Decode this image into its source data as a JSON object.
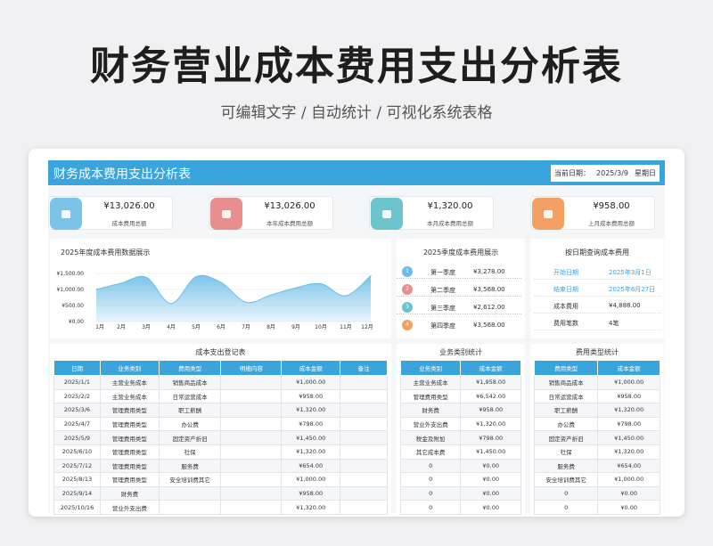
{
  "hero": {
    "title": "财务营业成本费用支出分析表",
    "subtitle": "可编辑文字 / 自动统计 / 可视化系统表格"
  },
  "header": {
    "title": "财务成本费用支出分析表",
    "date_label": "当前日期：",
    "date_value": "2025/3/9",
    "weekday": "星期日"
  },
  "kpis": [
    {
      "value": "¥13,026.00",
      "label": "成本费用总额",
      "color": "#7cc3e8"
    },
    {
      "value": "¥13,026.00",
      "label": "本年成本费用总额",
      "color": "#e88e8e"
    },
    {
      "value": "¥1,320.00",
      "label": "本月成本费用总额",
      "color": "#6ec4cc"
    },
    {
      "value": "¥958.00",
      "label": "上月成本费用总额",
      "color": "#f4a062"
    }
  ],
  "yearly_chart_title": "2025年度成本费用数据展示",
  "chart_data": {
    "type": "area",
    "title": "2025年度成本费用数据展示",
    "categories": [
      "1月",
      "2月",
      "3月",
      "4月",
      "5月",
      "6月",
      "7月",
      "8月",
      "9月",
      "10月",
      "11月",
      "12月"
    ],
    "values": [
      1000,
      1200,
      1380,
      560,
      1400,
      1220,
      600,
      830,
      1050,
      1180,
      800,
      1430
    ],
    "yticks": [
      "¥1,500.00",
      "¥1,000.00",
      "¥500.00",
      "¥0.00"
    ],
    "ylim": [
      0,
      1500
    ],
    "color": "#6cbce8"
  },
  "quarter": {
    "title": "2025季度成本费用展示",
    "rows": [
      {
        "n": "1",
        "name": "第一季度",
        "value": "¥3,278.00",
        "color": "#6cbce8"
      },
      {
        "n": "2",
        "name": "第二季度",
        "value": "¥3,568.00",
        "color": "#e88e8e"
      },
      {
        "n": "3",
        "name": "第三季度",
        "value": "¥2,612.00",
        "color": "#6ec4cc"
      },
      {
        "n": "4",
        "name": "第四季度",
        "value": "¥3,568.00",
        "color": "#f4a062"
      }
    ]
  },
  "query": {
    "title": "按日期查询成本费用",
    "rows": [
      {
        "k": "开始日期",
        "v": "2025年3月1日",
        "hl": true
      },
      {
        "k": "结束日期",
        "v": "2025年6月27日",
        "hl": true
      },
      {
        "k": "成本费用",
        "v": "¥4,888.00",
        "hl": false
      },
      {
        "k": "费用笔数",
        "v": "4笔",
        "hl": false
      }
    ]
  },
  "ledger": {
    "title": "成本支出登记表",
    "headers": [
      "日期",
      "业务类别",
      "费用类型",
      "明细内容",
      "成本金额",
      "备注"
    ],
    "rows": [
      [
        "2025/1/1",
        "主营业务成本",
        "销售商品成本",
        "",
        "¥1,000.00",
        ""
      ],
      [
        "2025/2/2",
        "主营业务成本",
        "日常运营成本",
        "",
        "¥958.00",
        ""
      ],
      [
        "2025/3/6",
        "管理费用类型",
        "职工薪酬",
        "",
        "¥1,320.00",
        ""
      ],
      [
        "2025/4/7",
        "管理费用类型",
        "办公费",
        "",
        "¥798.00",
        ""
      ],
      [
        "2025/5/9",
        "管理费用类型",
        "固定资产折旧",
        "",
        "¥1,450.00",
        ""
      ],
      [
        "2025/6/10",
        "管理费用类型",
        "社保",
        "",
        "¥1,320.00",
        ""
      ],
      [
        "2025/7/12",
        "管理费用类型",
        "服务费",
        "",
        "¥654.00",
        ""
      ],
      [
        "2025/8/13",
        "管理费用类型",
        "安全培训费其它",
        "",
        "¥1,000.00",
        ""
      ],
      [
        "2025/9/14",
        "财务费",
        "",
        "",
        "¥958.00",
        ""
      ],
      [
        "2025/10/16",
        "营业外支出费",
        "",
        "",
        "¥1,320.00",
        ""
      ]
    ]
  },
  "business": {
    "title": "业务类别统计",
    "headers": [
      "业务类别",
      "成本金额"
    ],
    "rows": [
      [
        "主营业务成本",
        "¥1,958.00"
      ],
      [
        "管理费用类型",
        "¥6,542.00"
      ],
      [
        "财务费",
        "¥958.00"
      ],
      [
        "营业外支出费",
        "¥1,320.00"
      ],
      [
        "税金及附加",
        "¥798.00"
      ],
      [
        "其它成本费",
        "¥1,450.00"
      ],
      [
        "0",
        "¥0.00"
      ],
      [
        "0",
        "¥0.00"
      ],
      [
        "0",
        "¥0.00"
      ],
      [
        "0",
        "¥0.00"
      ]
    ]
  },
  "expense": {
    "title": "费用类型统计",
    "headers": [
      "费用类型",
      "成本金额"
    ],
    "rows": [
      [
        "销售商品成本",
        "¥1,000.00"
      ],
      [
        "日常运营成本",
        "¥958.00"
      ],
      [
        "职工薪酬",
        "¥1,320.00"
      ],
      [
        "办公费",
        "¥798.00"
      ],
      [
        "固定资产折旧",
        "¥1,450.00"
      ],
      [
        "社保",
        "¥1,320.00"
      ],
      [
        "服务费",
        "¥654.00"
      ],
      [
        "安全培训费其它",
        "¥1,000.00"
      ],
      [
        "0",
        "¥0.00"
      ],
      [
        "0",
        "¥0.00"
      ]
    ]
  }
}
